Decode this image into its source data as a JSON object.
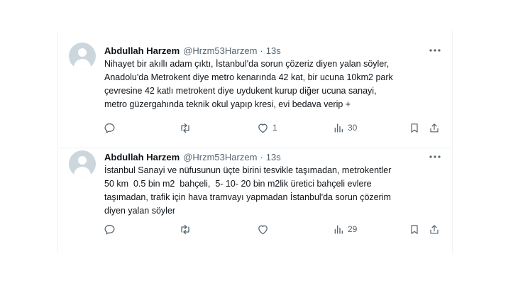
{
  "tweets": [
    {
      "author_name": "Abdullah Harzem",
      "handle": "@Hrzm53Harzem",
      "separator": "·",
      "time": "13s",
      "lines": [
        "Nihayet bir akıllı adam çıktı, İstanbul'da sorun çözeriz diyen yalan söyler,",
        "Anadolu'da Metrokent diye metro kenarında 42 kat, bir ucuna 10km2 park",
        "çevresine 42 katlı metrokent diye uydukent kurup diğer ucuna sanayi,",
        "metro güzergahında teknik okul yapıp kresi, evi bedava verip +"
      ],
      "replies": "",
      "retweets": "",
      "likes": "1",
      "views": "30"
    },
    {
      "author_name": "Abdullah Harzem",
      "handle": "@Hrzm53Harzem",
      "separator": "·",
      "time": "13s",
      "lines": [
        "İstanbul Sanayi ve nüfusunun üçte birini tesvikle taşımadan, metrokentler",
        "50 km  0.5 bin m2  bahçeli,  5- 10- 20 bin m2lik üretici bahçeli evlere",
        "taşımadan, trafik için hava tramvayı yapmadan İstanbul'da sorun çözerim",
        "diyen yalan söyler"
      ],
      "replies": "",
      "retweets": "",
      "likes": "",
      "views": "29"
    }
  ],
  "icons": {
    "avatar": "default-avatar-icon",
    "more": "more-horizontal-icon",
    "reply": "reply-icon",
    "retweet": "retweet-icon",
    "like": "heart-icon",
    "views": "views-chart-icon",
    "bookmark": "bookmark-icon",
    "share": "share-icon"
  },
  "colors": {
    "text_primary": "#0f1419",
    "text_secondary": "#536471",
    "divider": "#eff3f4",
    "avatar_bg": "#ccd6dd"
  }
}
